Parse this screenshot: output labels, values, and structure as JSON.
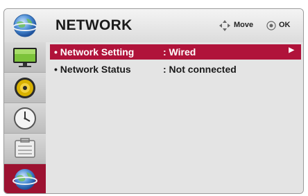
{
  "header": {
    "title": "NETWORK",
    "move_label": "Move",
    "ok_label": "OK"
  },
  "sidebar": {
    "items": [
      {
        "icon": "picture-monitor-icon",
        "active": false
      },
      {
        "icon": "speaker-audio-icon",
        "active": false
      },
      {
        "icon": "clock-time-icon",
        "active": false
      },
      {
        "icon": "option-toolbox-icon",
        "active": false
      },
      {
        "icon": "network-globe-icon",
        "active": true
      }
    ]
  },
  "menu": {
    "rows": [
      {
        "label": "• Network Setting",
        "value": ": Wired",
        "selected": true,
        "arrow": "▶"
      },
      {
        "label": "• Network Status",
        "value": ": Not connected",
        "selected": false
      }
    ]
  },
  "colors": {
    "accent": "#b0133a",
    "sidebar_active": "#9c1231"
  }
}
